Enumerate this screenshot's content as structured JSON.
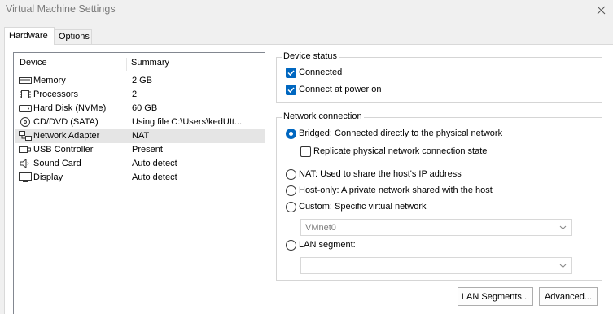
{
  "window": {
    "title": "Virtual Machine Settings"
  },
  "tabs": [
    {
      "label": "Hardware"
    },
    {
      "label": "Options"
    }
  ],
  "device_list": {
    "headers": {
      "device": "Device",
      "summary": "Summary"
    },
    "rows": [
      {
        "icon": "memory-icon",
        "device": "Memory",
        "summary": "2 GB"
      },
      {
        "icon": "processor-icon",
        "device": "Processors",
        "summary": "2"
      },
      {
        "icon": "hard-disk-icon",
        "device": "Hard Disk (NVMe)",
        "summary": "60 GB"
      },
      {
        "icon": "cd-dvd-icon",
        "device": "CD/DVD (SATA)",
        "summary": "Using file C:\\Users\\kedUIt..."
      },
      {
        "icon": "network-adapter-icon",
        "device": "Network Adapter",
        "summary": "NAT",
        "selected": true
      },
      {
        "icon": "usb-icon",
        "device": "USB Controller",
        "summary": "Present"
      },
      {
        "icon": "sound-card-icon",
        "device": "Sound Card",
        "summary": "Auto detect"
      },
      {
        "icon": "display-icon",
        "device": "Display",
        "summary": "Auto detect"
      }
    ]
  },
  "device_status": {
    "title": "Device status",
    "connected": {
      "label": "Connected",
      "checked": true
    },
    "connect_at_power_on": {
      "label": "Connect at power on",
      "checked": true
    }
  },
  "network_connection": {
    "title": "Network connection",
    "bridged": {
      "label": "Bridged: Connected directly to the physical network",
      "selected": true
    },
    "replicate": {
      "label": "Replicate physical network connection state",
      "checked": false
    },
    "nat": {
      "label": "NAT: Used to share the host's IP address",
      "selected": false
    },
    "host_only": {
      "label": "Host-only: A private network shared with the host",
      "selected": false
    },
    "custom": {
      "label": "Custom: Specific virtual network",
      "selected": false
    },
    "custom_select_value": "VMnet0",
    "lan_segment": {
      "label": "LAN segment:",
      "selected": false
    },
    "lan_select_value": ""
  },
  "buttons": {
    "lan_segments": "LAN Segments...",
    "advanced": "Advanced..."
  },
  "colors": {
    "accent": "#0067c0",
    "selected_row": "#e5e5e5",
    "title_text": "#7a7a7a"
  }
}
